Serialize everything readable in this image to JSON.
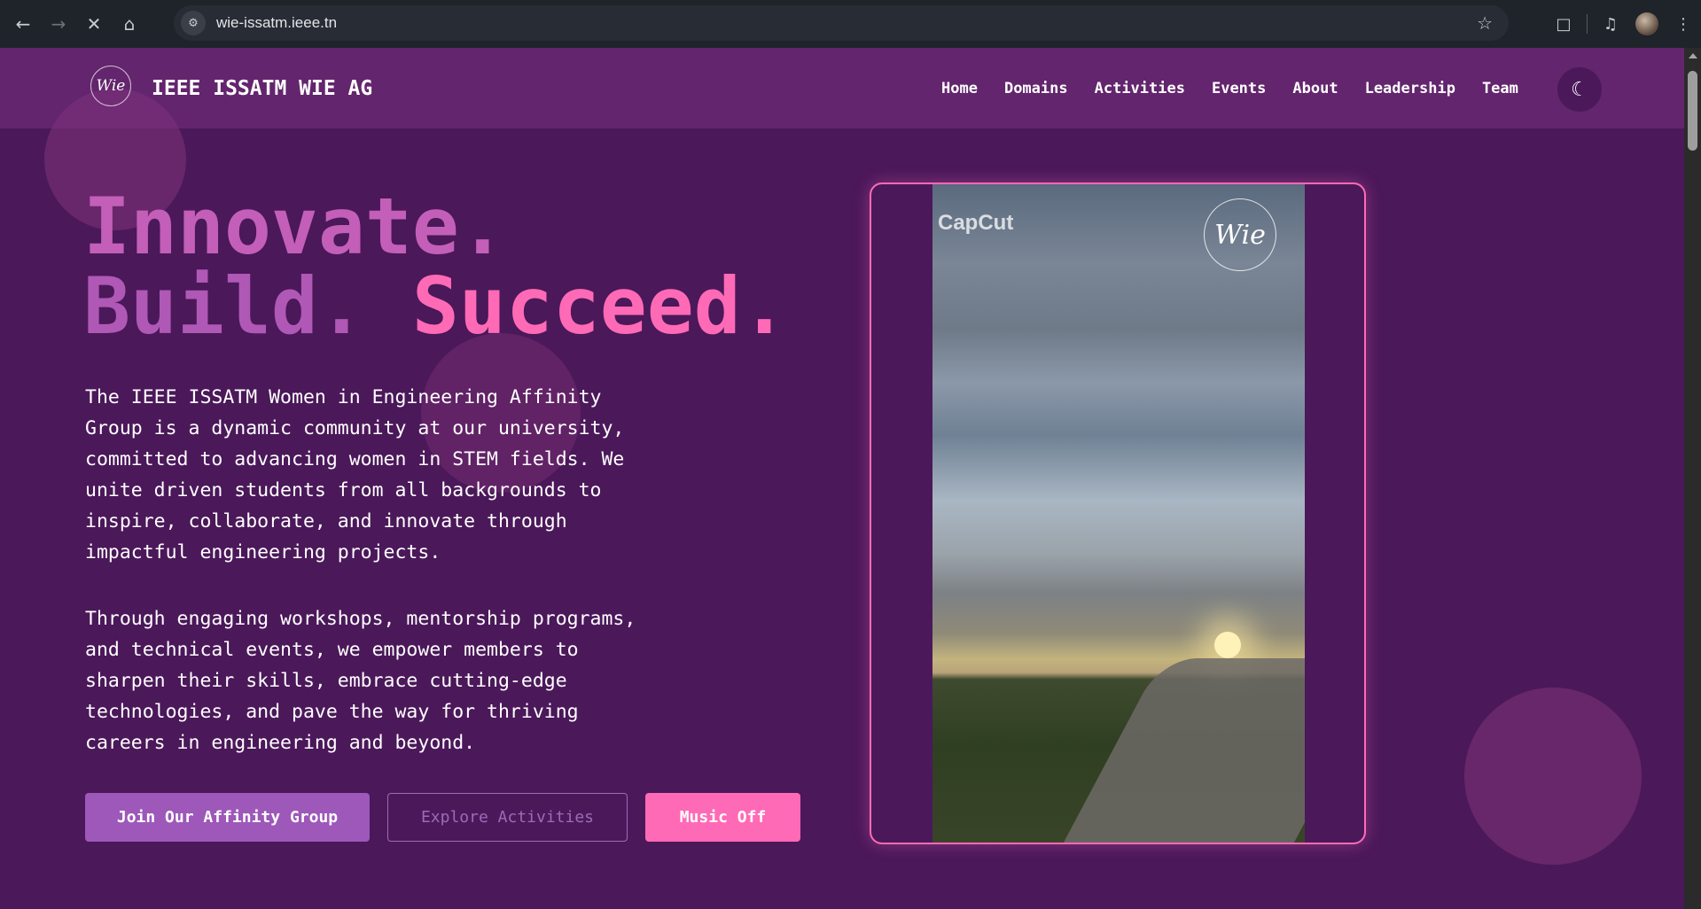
{
  "browser": {
    "url": "wie-issatm.ieee.tn",
    "back_icon": "arrow-left",
    "forward_icon": "arrow-right",
    "stop_icon": "close",
    "home_icon": "home"
  },
  "header": {
    "logo_text": "Wie",
    "brand": "IEEE ISSATM WIE AG",
    "nav": [
      "Home",
      "Domains",
      "Activities",
      "Events",
      "About",
      "Leadership",
      "Team"
    ],
    "theme_icon": "moon"
  },
  "hero": {
    "headline_line1": "Innovate.",
    "headline_line2a": "Build.",
    "headline_line2b": "Succeed.",
    "paragraph1": "The IEEE ISSATM Women in Engineering Affinity Group is a dynamic community at our university, committed to advancing women in STEM fields. We unite driven students from all backgrounds to inspire, collaborate, and innovate through impactful engineering projects.",
    "paragraph2": "Through engaging workshops, mentorship programs, and technical events, we empower members to sharpen their skills, embrace cutting-edge technologies, and pave the way for thriving careers in engineering and beyond.",
    "buttons": {
      "join": "Join Our Affinity Group",
      "explore": "Explore Activities",
      "music": "Music Off"
    }
  },
  "video": {
    "watermark": "CapCut",
    "badge_text": "Wie"
  },
  "colors": {
    "background": "#4b185a",
    "accent_pink": "#ff6ab6",
    "accent_purple": "#9d58b9"
  }
}
